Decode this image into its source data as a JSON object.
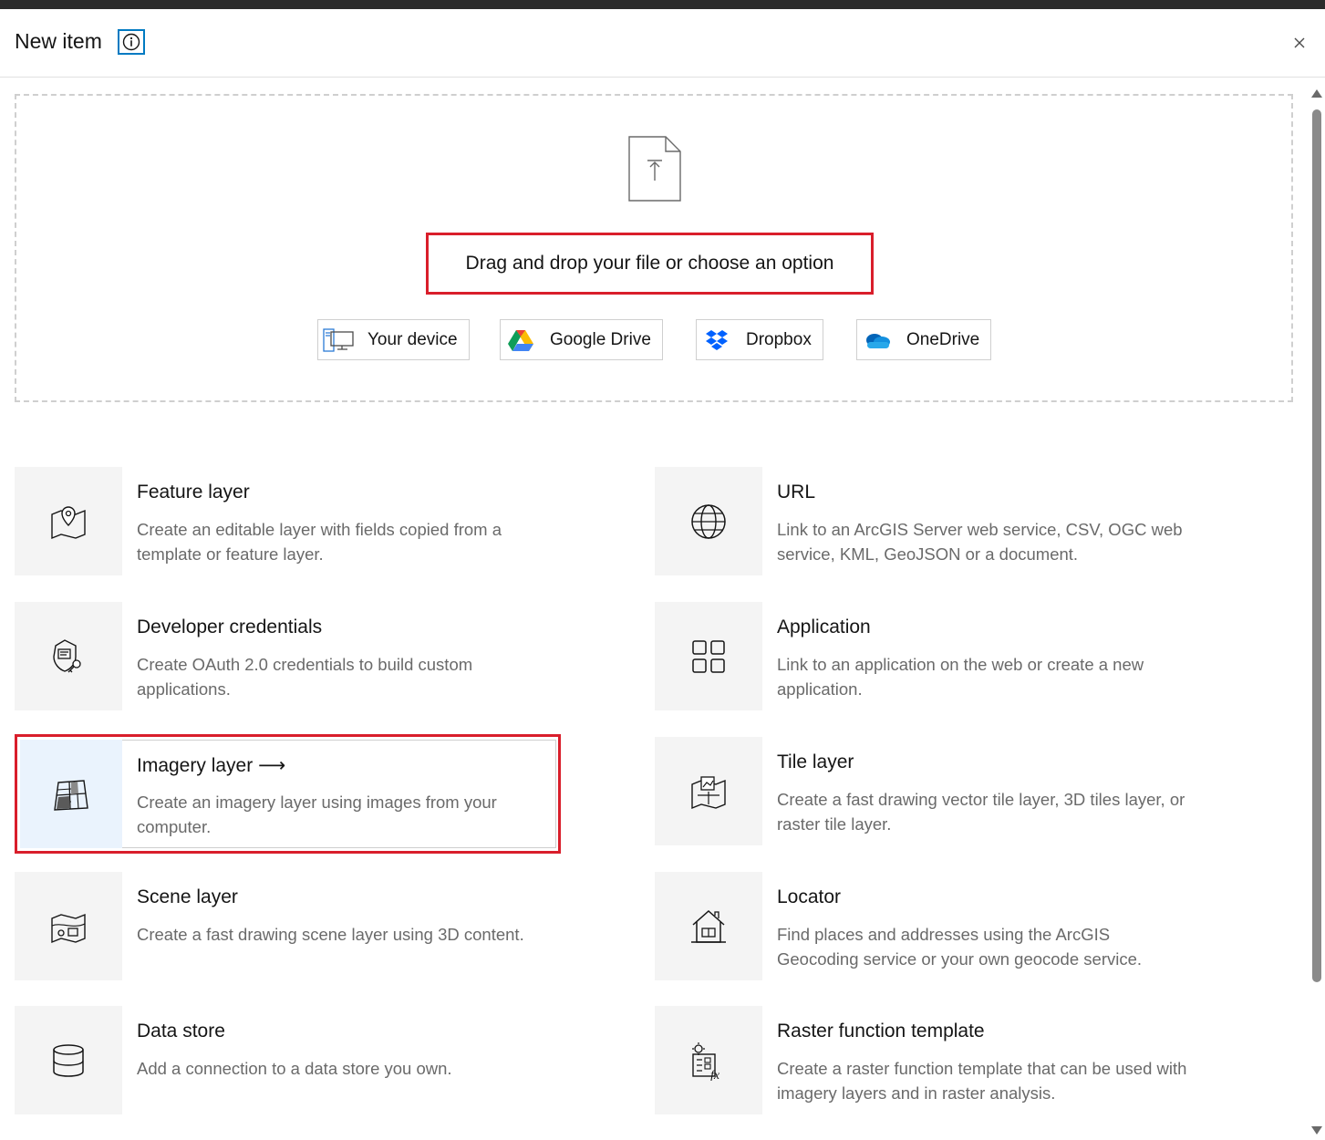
{
  "header": {
    "title": "New item"
  },
  "dropzone": {
    "prompt": "Drag and drop your file or choose an option",
    "options": [
      {
        "label": "Your device",
        "icon": "device-icon"
      },
      {
        "label": "Google Drive",
        "icon": "google-drive-icon"
      },
      {
        "label": "Dropbox",
        "icon": "dropbox-icon"
      },
      {
        "label": "OneDrive",
        "icon": "onedrive-icon"
      }
    ]
  },
  "items": [
    {
      "name": "Feature layer",
      "desc": "Create an editable layer with fields copied from a template or feature layer.",
      "icon": "feature-layer-icon"
    },
    {
      "name": "URL",
      "desc": "Link to an ArcGIS Server web service, CSV, OGC web service, KML, GeoJSON or a document.",
      "icon": "globe-icon"
    },
    {
      "name": "Developer credentials",
      "desc": "Create OAuth 2.0 credentials to build custom applications.",
      "icon": "credentials-icon"
    },
    {
      "name": "Application",
      "desc": "Link to an application on the web or create a new application.",
      "icon": "apps-grid-icon"
    },
    {
      "name": "Imagery layer",
      "arrow": "⟶",
      "desc": "Create an imagery layer using images from your computer.",
      "icon": "imagery-layer-icon"
    },
    {
      "name": "Tile layer",
      "desc": "Create a fast drawing vector tile layer, 3D tiles layer, or raster tile layer.",
      "icon": "tile-layer-icon"
    },
    {
      "name": "Scene layer",
      "desc": "Create a fast drawing scene layer using 3D content.",
      "icon": "scene-layer-icon"
    },
    {
      "name": "Locator",
      "desc": "Find places and addresses using the ArcGIS Geocoding service or your own geocode service.",
      "icon": "locator-house-icon"
    },
    {
      "name": "Data store",
      "desc": "Add a connection to a data store you own.",
      "icon": "data-store-icon"
    },
    {
      "name": "Raster function template",
      "desc": "Create a raster function template that can be used with imagery layers and in raster analysis.",
      "icon": "raster-function-icon"
    }
  ],
  "colors": {
    "accent": "#007ac2",
    "highlight": "#d91e2b",
    "tile": "#f4f4f4"
  }
}
